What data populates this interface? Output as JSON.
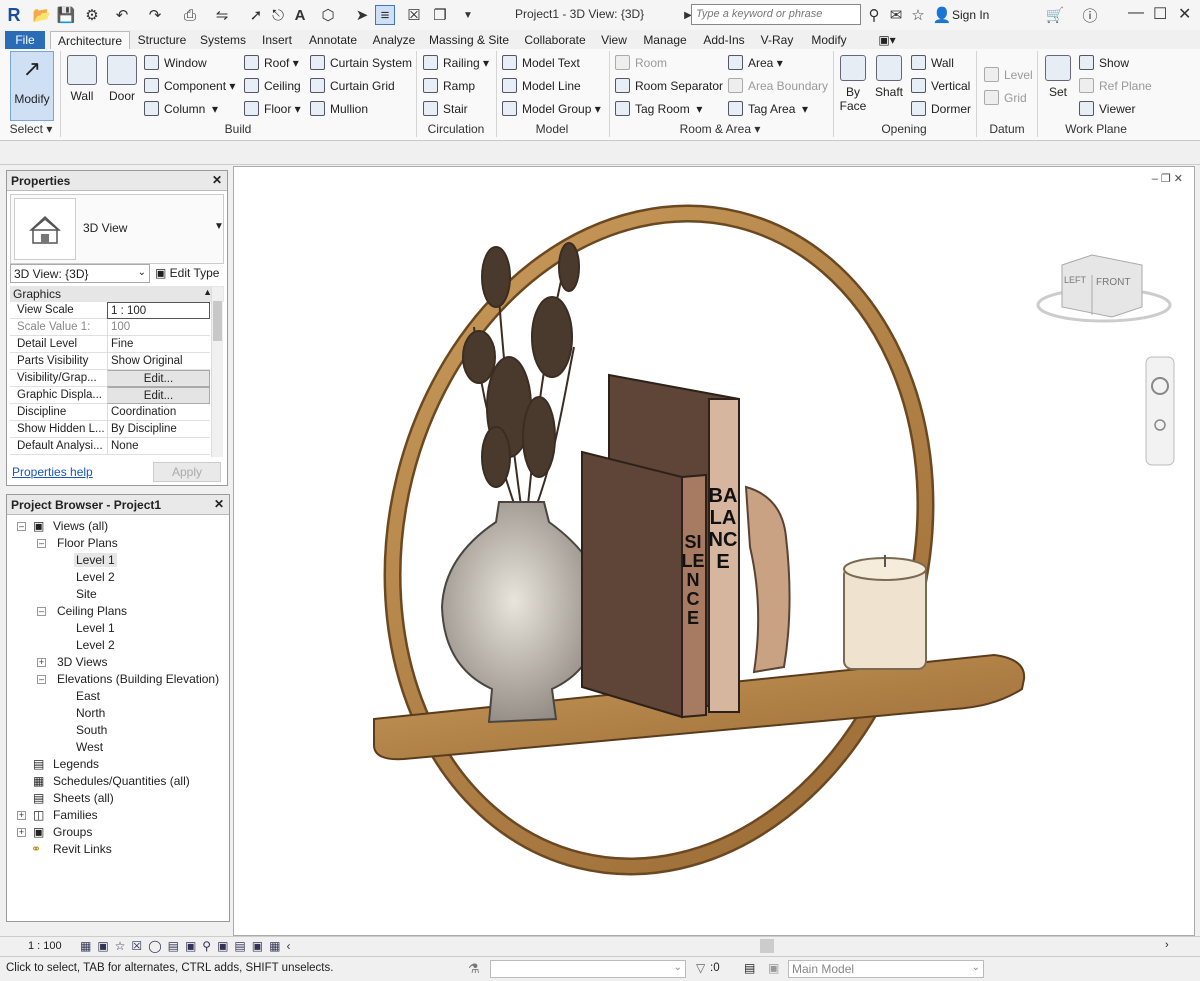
{
  "app": {
    "title": "Project1 - 3D View: {3D}",
    "logo": "R"
  },
  "search": {
    "placeholder": "Type a keyword or phrase"
  },
  "account": {
    "sign_in": "Sign In"
  },
  "tabs": [
    "File",
    "Architecture",
    "Structure",
    "Systems",
    "Insert",
    "Annotate",
    "Analyze",
    "Massing & Site",
    "Collaborate",
    "View",
    "Manage",
    "Add-Ins",
    "V-Ray",
    "Modify"
  ],
  "ribbon": {
    "select": {
      "modify": "Modify",
      "select": "Select"
    },
    "build": {
      "label": "Build",
      "wall": "Wall",
      "door": "Door",
      "window": "Window",
      "component": "Component",
      "column": "Column",
      "roof": "Roof",
      "ceiling": "Ceiling",
      "floor": "Floor",
      "curtain_system": "Curtain System",
      "curtain_grid": "Curtain Grid",
      "mullion": "Mullion"
    },
    "circulation": {
      "label": "Circulation",
      "railing": "Railing",
      "ramp": "Ramp",
      "stair": "Stair"
    },
    "model": {
      "label": "Model",
      "model_text": "Model Text",
      "model_line": "Model Line",
      "model_group": "Model Group"
    },
    "room_area": {
      "label": "Room & Area",
      "room": "Room",
      "room_separator": "Room Separator",
      "tag_room": "Tag Room",
      "area": "Area",
      "area_boundary": "Area Boundary",
      "tag_area": "Tag Area"
    },
    "opening": {
      "label": "Opening",
      "by_face": "By Face",
      "shaft": "Shaft",
      "wall": "Wall",
      "vertical": "Vertical",
      "dormer": "Dormer"
    },
    "datum": {
      "label": "Datum",
      "level": "Level",
      "grid": "Grid"
    },
    "work_plane": {
      "label": "Work Plane",
      "set": "Set",
      "show": "Show",
      "ref_plane": "Ref Plane",
      "viewer": "Viewer"
    }
  },
  "properties": {
    "title": "Properties",
    "type_name": "3D View",
    "view_selector": "3D View: {3D}",
    "edit_type": "Edit Type",
    "section": "Graphics",
    "rows": [
      {
        "k": "View Scale",
        "v": "1 : 100"
      },
      {
        "k": "Scale Value 1:",
        "v": "100"
      },
      {
        "k": "Detail Level",
        "v": "Fine"
      },
      {
        "k": "Parts Visibility",
        "v": "Show Original"
      },
      {
        "k": "Visibility/Grap...",
        "v": "Edit..."
      },
      {
        "k": "Graphic Displa...",
        "v": "Edit..."
      },
      {
        "k": "Discipline",
        "v": "Coordination"
      },
      {
        "k": "Show Hidden L...",
        "v": "By Discipline"
      },
      {
        "k": "Default Analysi...",
        "v": "None"
      }
    ],
    "help": "Properties help",
    "apply": "Apply"
  },
  "browser": {
    "title": "Project Browser - Project1",
    "views_all": "Views (all)",
    "floor_plans": "Floor Plans",
    "fp_level1": "Level 1",
    "fp_level2": "Level 2",
    "fp_site": "Site",
    "ceiling_plans": "Ceiling Plans",
    "cp_level1": "Level 1",
    "cp_level2": "Level 2",
    "views_3d": "3D Views",
    "elevations": "Elevations (Building Elevation)",
    "east": "East",
    "north": "North",
    "south": "South",
    "west": "West",
    "legends": "Legends",
    "schedules": "Schedules/Quantities (all)",
    "sheets": "Sheets (all)",
    "families": "Families",
    "groups": "Groups",
    "revit_links": "Revit Links"
  },
  "viewport": {
    "book_top": "BALANCE",
    "book_front": "SILENCE",
    "cube_left": "LEFT",
    "cube_front": "FRONT"
  },
  "viewbar": {
    "scale": "1 : 100"
  },
  "status": {
    "hint": "Click to select, TAB for alternates, CTRL adds, SHIFT unselects.",
    "count": ":0",
    "model": "Main Model"
  },
  "colors": {
    "file_tab": "#2b6cb7",
    "wood": "#b98a4e",
    "book_dark": "#5e4537",
    "book_light": "#d7b6a0"
  }
}
